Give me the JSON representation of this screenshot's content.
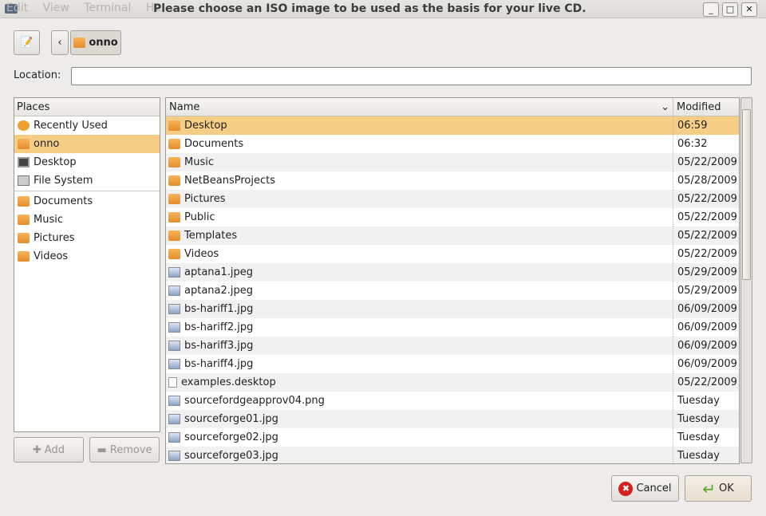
{
  "window": {
    "title": "Please choose an ISO image to be used as the basis for your live CD.",
    "background_menu": "Edit  View  Terminal  He"
  },
  "toolbar": {
    "path_button": "onno"
  },
  "location": {
    "label": "Location:",
    "value": ""
  },
  "places": {
    "header": "Places",
    "items": [
      {
        "label": "Recently Used",
        "icon": "clock-icon"
      },
      {
        "label": "onno",
        "icon": "home-folder-icon",
        "selected": true
      },
      {
        "label": "Desktop",
        "icon": "desktop-icon"
      },
      {
        "label": "File System",
        "icon": "drive-icon"
      }
    ],
    "bookmarks": [
      {
        "label": "Documents"
      },
      {
        "label": "Music"
      },
      {
        "label": "Pictures"
      },
      {
        "label": "Videos"
      }
    ],
    "add_label": "Add",
    "remove_label": "Remove"
  },
  "files": {
    "col_name": "Name",
    "col_modified": "Modified",
    "rows": [
      {
        "name": "Desktop",
        "modified": "06:59",
        "icon": "desktop-folder-icon",
        "selected": true
      },
      {
        "name": "Documents",
        "modified": "06:32",
        "icon": "folder-icon"
      },
      {
        "name": "Music",
        "modified": "05/22/2009",
        "icon": "folder-icon"
      },
      {
        "name": "NetBeansProjects",
        "modified": "05/28/2009",
        "icon": "folder-icon"
      },
      {
        "name": "Pictures",
        "modified": "05/22/2009",
        "icon": "folder-icon"
      },
      {
        "name": "Public",
        "modified": "05/22/2009",
        "icon": "folder-icon"
      },
      {
        "name": "Templates",
        "modified": "05/22/2009",
        "icon": "folder-icon"
      },
      {
        "name": "Videos",
        "modified": "05/22/2009",
        "icon": "folder-icon"
      },
      {
        "name": "aptana1.jpeg",
        "modified": "05/29/2009",
        "icon": "image-icon"
      },
      {
        "name": "aptana2.jpeg",
        "modified": "05/29/2009",
        "icon": "image-icon"
      },
      {
        "name": "bs-hariff1.jpg",
        "modified": "06/09/2009",
        "icon": "image-icon"
      },
      {
        "name": "bs-hariff2.jpg",
        "modified": "06/09/2009",
        "icon": "image-icon"
      },
      {
        "name": "bs-hariff3.jpg",
        "modified": "06/09/2009",
        "icon": "image-icon"
      },
      {
        "name": "bs-hariff4.jpg",
        "modified": "06/09/2009",
        "icon": "image-icon"
      },
      {
        "name": "examples.desktop",
        "modified": "05/22/2009",
        "icon": "text-file-icon"
      },
      {
        "name": "sourcefordgeapprov04.png",
        "modified": "Tuesday",
        "icon": "image-icon"
      },
      {
        "name": "sourceforge01.jpg",
        "modified": "Tuesday",
        "icon": "image-icon"
      },
      {
        "name": "sourceforge02.jpg",
        "modified": "Tuesday",
        "icon": "image-icon"
      },
      {
        "name": "sourceforge03.jpg",
        "modified": "Tuesday",
        "icon": "image-icon"
      }
    ]
  },
  "buttons": {
    "cancel": "Cancel",
    "ok": "OK"
  },
  "colors": {
    "selection": "#f6cd85",
    "folder": "#e99a3c"
  }
}
